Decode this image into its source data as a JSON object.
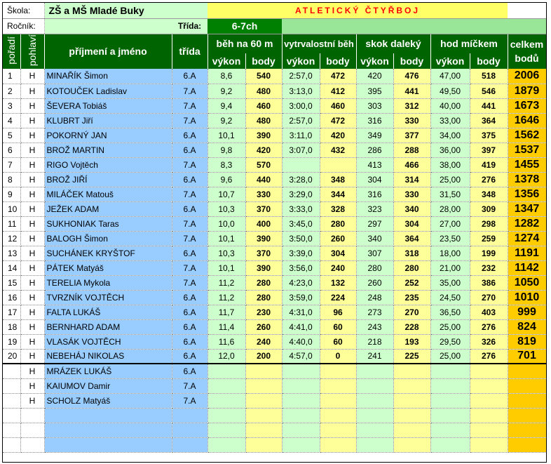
{
  "header": {
    "skola_label": "Škola:",
    "skola_value": "ZŠ a MŠ Mladé Buky",
    "title": "ATLETICKÝ ČTYŘBOJ",
    "rocnik_label": "Ročník:",
    "trida_label": "Třída:",
    "trida_value": "6-7ch"
  },
  "columns": {
    "poradi": "pořadí",
    "pohlavi": "pohlaví",
    "name": "příjmení a jméno",
    "trida": "třída",
    "beh60": "běh na 60 m",
    "vytrvalostni": "vytrvalostní běh",
    "skok": "skok daleký",
    "hod": "hod míčkem",
    "celkem": "celkem bodů",
    "vykon": "výkon",
    "body": "body"
  },
  "rows": [
    {
      "idx": "1",
      "pohl": "H",
      "name": "MINAŘÍK Šimon",
      "trida": "6.A",
      "b60v": "8,6",
      "b60b": "540",
      "vbv": "2:57,0",
      "vbb": "472",
      "skv": "420",
      "skb": "476",
      "hmv": "47,00",
      "hmb": "518",
      "tot": "2006"
    },
    {
      "idx": "2",
      "pohl": "H",
      "name": "KOTOUČEK Ladislav",
      "trida": "7.A",
      "b60v": "9,2",
      "b60b": "480",
      "vbv": "3:13,0",
      "vbb": "412",
      "skv": "395",
      "skb": "441",
      "hmv": "49,50",
      "hmb": "546",
      "tot": "1879"
    },
    {
      "idx": "3",
      "pohl": "H",
      "name": "ŠEVERA Tobiáš",
      "trida": "7.A",
      "b60v": "9,4",
      "b60b": "460",
      "vbv": "3:00,0",
      "vbb": "460",
      "skv": "303",
      "skb": "312",
      "hmv": "40,00",
      "hmb": "441",
      "tot": "1673"
    },
    {
      "idx": "4",
      "pohl": "H",
      "name": "KLUBRT Jiří",
      "trida": "7.A",
      "b60v": "9,2",
      "b60b": "480",
      "vbv": "2:57,0",
      "vbb": "472",
      "skv": "316",
      "skb": "330",
      "hmv": "33,00",
      "hmb": "364",
      "tot": "1646"
    },
    {
      "idx": "5",
      "pohl": "H",
      "name": "POKORNÝ JAN",
      "trida": "6.A",
      "b60v": "10,1",
      "b60b": "390",
      "vbv": "3:11,0",
      "vbb": "420",
      "skv": "349",
      "skb": "377",
      "hmv": "34,00",
      "hmb": "375",
      "tot": "1562"
    },
    {
      "idx": "6",
      "pohl": "H",
      "name": "BROŽ MARTIN",
      "trida": "6.A",
      "b60v": "9,8",
      "b60b": "420",
      "vbv": "3:07,0",
      "vbb": "432",
      "skv": "286",
      "skb": "288",
      "hmv": "36,00",
      "hmb": "397",
      "tot": "1537"
    },
    {
      "idx": "7",
      "pohl": "H",
      "name": "RIGO Vojtěch",
      "trida": "7.A",
      "b60v": "8,3",
      "b60b": "570",
      "vbv": "",
      "vbb": "",
      "skv": "413",
      "skb": "466",
      "hmv": "38,00",
      "hmb": "419",
      "tot": "1455"
    },
    {
      "idx": "8",
      "pohl": "H",
      "name": "BROŽ JIŘÍ",
      "trida": "6.A",
      "b60v": "9,6",
      "b60b": "440",
      "vbv": "3:28,0",
      "vbb": "348",
      "skv": "304",
      "skb": "314",
      "hmv": "25,00",
      "hmb": "276",
      "tot": "1378"
    },
    {
      "idx": "9",
      "pohl": "H",
      "name": "MILÁČEK Matouš",
      "trida": "7.A",
      "b60v": "10,7",
      "b60b": "330",
      "vbv": "3:29,0",
      "vbb": "344",
      "skv": "316",
      "skb": "330",
      "hmv": "31,50",
      "hmb": "348",
      "tot": "1356"
    },
    {
      "idx": "10",
      "pohl": "H",
      "name": "JEŽEK ADAM",
      "trida": "6.A",
      "b60v": "10,3",
      "b60b": "370",
      "vbv": "3:33,0",
      "vbb": "328",
      "skv": "323",
      "skb": "340",
      "hmv": "28,00",
      "hmb": "309",
      "tot": "1347"
    },
    {
      "idx": "11",
      "pohl": "H",
      "name": "SUKHONIAK Taras",
      "trida": "7.A",
      "b60v": "10,0",
      "b60b": "400",
      "vbv": "3:45,0",
      "vbb": "280",
      "skv": "297",
      "skb": "304",
      "hmv": "27,00",
      "hmb": "298",
      "tot": "1282"
    },
    {
      "idx": "12",
      "pohl": "H",
      "name": "BALOGH Šimon",
      "trida": "7.A",
      "b60v": "10,1",
      "b60b": "390",
      "vbv": "3:50,0",
      "vbb": "260",
      "skv": "340",
      "skb": "364",
      "hmv": "23,50",
      "hmb": "259",
      "tot": "1274"
    },
    {
      "idx": "13",
      "pohl": "H",
      "name": "SUCHÁNEK KRYŠTOF",
      "trida": "6.A",
      "b60v": "10,3",
      "b60b": "370",
      "vbv": "3:39,0",
      "vbb": "304",
      "skv": "307",
      "skb": "318",
      "hmv": "18,00",
      "hmb": "199",
      "tot": "1191"
    },
    {
      "idx": "14",
      "pohl": "H",
      "name": "PÁTEK Matyáš",
      "trida": "7.A",
      "b60v": "10,1",
      "b60b": "390",
      "vbv": "3:56,0",
      "vbb": "240",
      "skv": "280",
      "skb": "280",
      "hmv": "21,00",
      "hmb": "232",
      "tot": "1142"
    },
    {
      "idx": "15",
      "pohl": "H",
      "name": "TERELIA Mykola",
      "trida": "7.A",
      "b60v": "11,2",
      "b60b": "280",
      "vbv": "4:23,0",
      "vbb": "132",
      "skv": "260",
      "skb": "252",
      "hmv": "35,00",
      "hmb": "386",
      "tot": "1050"
    },
    {
      "idx": "16",
      "pohl": "H",
      "name": "TVRZNÍK VOJTĚCH",
      "trida": "6.A",
      "b60v": "11,2",
      "b60b": "280",
      "vbv": "3:59,0",
      "vbb": "224",
      "skv": "248",
      "skb": "235",
      "hmv": "24,50",
      "hmb": "270",
      "tot": "1010"
    },
    {
      "idx": "17",
      "pohl": "H",
      "name": "FALTA LUKÁŠ",
      "trida": "6.A",
      "b60v": "11,7",
      "b60b": "230",
      "vbv": "4:31,0",
      "vbb": "96",
      "skv": "273",
      "skb": "270",
      "hmv": "36,50",
      "hmb": "403",
      "tot": "999"
    },
    {
      "idx": "18",
      "pohl": "H",
      "name": "BERNHARD ADAM",
      "trida": "6.A",
      "b60v": "11,4",
      "b60b": "260",
      "vbv": "4:41,0",
      "vbb": "60",
      "skv": "243",
      "skb": "228",
      "hmv": "25,00",
      "hmb": "276",
      "tot": "824"
    },
    {
      "idx": "19",
      "pohl": "H",
      "name": "VLASÁK VOJTĚCH",
      "trida": "6.A",
      "b60v": "11,6",
      "b60b": "240",
      "vbv": "4:40,0",
      "vbb": "60",
      "skv": "218",
      "skb": "193",
      "hmv": "29,50",
      "hmb": "326",
      "tot": "819"
    },
    {
      "idx": "20",
      "pohl": "H",
      "name": "NEBEHÁJ NIKOLAS",
      "trida": "6.A",
      "b60v": "12,0",
      "b60b": "200",
      "vbv": "4:57,0",
      "vbb": "0",
      "skv": "241",
      "skb": "225",
      "hmv": "25,00",
      "hmb": "276",
      "tot": "701"
    },
    {
      "idx": "",
      "pohl": "H",
      "name": "MRÁZEK LUKÁŠ",
      "trida": "6.A",
      "b60v": "",
      "b60b": "",
      "vbv": "",
      "vbb": "",
      "skv": "",
      "skb": "",
      "hmv": "",
      "hmb": "",
      "tot": ""
    },
    {
      "idx": "",
      "pohl": "H",
      "name": "KAIUMOV Damir",
      "trida": "7.A",
      "b60v": "",
      "b60b": "",
      "vbv": "",
      "vbb": "",
      "skv": "",
      "skb": "",
      "hmv": "",
      "hmb": "",
      "tot": ""
    },
    {
      "idx": "",
      "pohl": "H",
      "name": "SCHOLZ Matyáš",
      "trida": "7.A",
      "b60v": "",
      "b60b": "",
      "vbv": "",
      "vbb": "",
      "skv": "",
      "skb": "",
      "hmv": "",
      "hmb": "",
      "tot": ""
    },
    {
      "idx": "",
      "pohl": "",
      "name": "",
      "trida": "",
      "b60v": "",
      "b60b": "",
      "vbv": "",
      "vbb": "",
      "skv": "",
      "skb": "",
      "hmv": "",
      "hmb": "",
      "tot": ""
    },
    {
      "idx": "",
      "pohl": "",
      "name": "",
      "trida": "",
      "b60v": "",
      "b60b": "",
      "vbv": "",
      "vbb": "",
      "skv": "",
      "skb": "",
      "hmv": "",
      "hmb": "",
      "tot": ""
    },
    {
      "idx": "",
      "pohl": "",
      "name": "",
      "trida": "",
      "b60v": "",
      "b60b": "",
      "vbv": "",
      "vbb": "",
      "skv": "",
      "skb": "",
      "hmv": "",
      "hmb": "",
      "tot": ""
    }
  ]
}
